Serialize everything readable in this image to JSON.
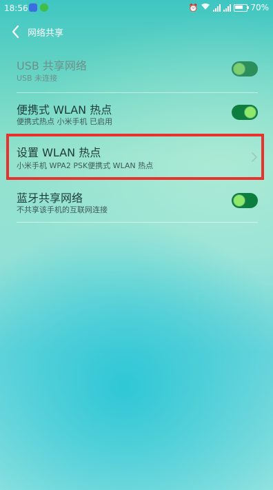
{
  "status": {
    "time": "18:56",
    "battery": "70%",
    "notif_colors": [
      "#3b6ee0",
      "#3fbf4a"
    ]
  },
  "header": {
    "back_icon": "chevron-left-icon",
    "title": "网络共享"
  },
  "items": [
    {
      "title": "USB 共享网络",
      "subtitle": "USB 未连接",
      "control": "toggle",
      "state": "on",
      "disabled": true
    },
    {
      "title": "便携式 WLAN 热点",
      "subtitle": "便携式热点 小米手机 已启用",
      "control": "toggle",
      "state": "on",
      "disabled": false
    },
    {
      "title": "设置 WLAN 热点",
      "subtitle": "小米手机 WPA2 PSK便携式 WLAN 热点",
      "control": "chevron",
      "highlighted": true
    },
    {
      "title": "蓝牙共享网络",
      "subtitle": "不共享该手机的互联网连接",
      "control": "toggle",
      "state": "on",
      "disabled": false
    }
  ],
  "colors": {
    "highlight": "#e8322e",
    "toggle_track": "#0e7e3f",
    "toggle_knob": "#8ee86a"
  }
}
